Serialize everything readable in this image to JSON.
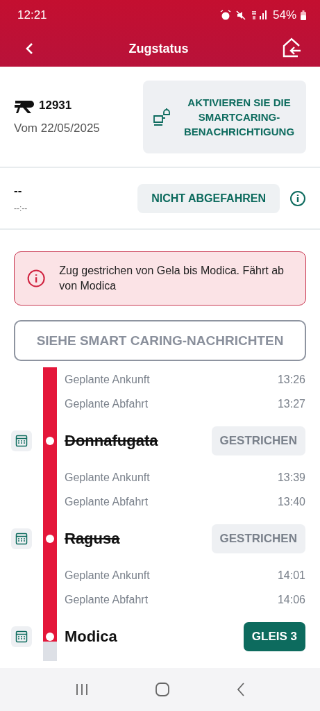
{
  "status_bar": {
    "time": "12:21",
    "battery": "54%"
  },
  "header": {
    "title": "Zugstatus"
  },
  "train": {
    "number": "12931",
    "date": "Vom 22/05/2025",
    "notify_button": "AKTIVIEREN SIE DIE SMARTCARING-BENACHRICHTIGUNG"
  },
  "departure": {
    "station": "--",
    "time": "--:--",
    "status": "NICHT ABGEFAHREN"
  },
  "alert": {
    "text": "Zug gestrichen von Gela bis Modica. Fährt ab von Modica"
  },
  "messages_button": "SIEHE SMART CARING-NACHRICHTEN",
  "stops": [
    {
      "times": [
        {
          "label": "Geplante Ankunft",
          "time": "13:26"
        },
        {
          "label": "Geplante Abfahrt",
          "time": "13:27"
        }
      ],
      "name": "Donnafugata",
      "cancelled": true,
      "badge": {
        "kind": "status",
        "text": "GESTRICHEN"
      }
    },
    {
      "times": [
        {
          "label": "Geplante Ankunft",
          "time": "13:39"
        },
        {
          "label": "Geplante Abfahrt",
          "time": "13:40"
        }
      ],
      "name": "Ragusa",
      "cancelled": true,
      "badge": {
        "kind": "status",
        "text": "GESTRICHEN"
      }
    },
    {
      "times": [
        {
          "label": "Geplante Ankunft",
          "time": "14:01"
        },
        {
          "label": "Geplante Abfahrt",
          "time": "14:06"
        }
      ],
      "name": "Modica",
      "cancelled": false,
      "badge": {
        "kind": "platform",
        "text": "GLEIS 3"
      }
    }
  ]
}
